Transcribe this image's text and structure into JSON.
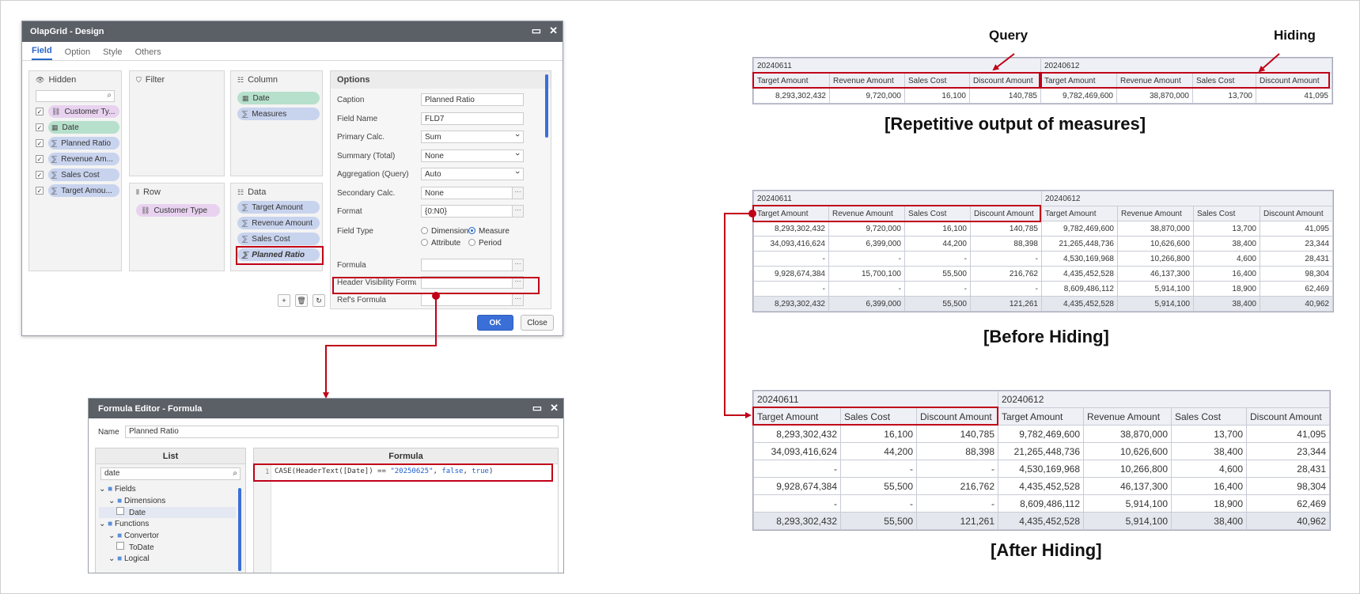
{
  "dialog": {
    "title": "OlapGrid - Design",
    "tabs": [
      "Field",
      "Option",
      "Style",
      "Others"
    ],
    "hidden": {
      "title": "Hidden",
      "items": [
        "Customer Ty...",
        "Date",
        "Planned Ratio",
        "Revenue Am...",
        "Sales Cost",
        "Target Amou..."
      ]
    },
    "filter": {
      "title": "Filter"
    },
    "column": {
      "title": "Column",
      "items": [
        "Date",
        "Measures"
      ]
    },
    "row": {
      "title": "Row",
      "items": [
        "Customer Type"
      ]
    },
    "data": {
      "title": "Data",
      "items": [
        "Target Amount",
        "Revenue Amount",
        "Sales Cost",
        "Planned Ratio"
      ]
    },
    "options": {
      "title": "Options",
      "caption": {
        "label": "Caption",
        "value": "Planned Ratio"
      },
      "field_name": {
        "label": "Field Name",
        "value": "FLD7"
      },
      "primary_calc": {
        "label": "Primary Calc.",
        "value": "Sum"
      },
      "summary_total": {
        "label": "Summary (Total)",
        "value": "None"
      },
      "aggregation": {
        "label": "Aggregation (Query)",
        "value": "Auto"
      },
      "secondary_calc": {
        "label": "Secondary Calc.",
        "value": "None"
      },
      "format": {
        "label": "Format",
        "value": "{0:N0}"
      },
      "field_type": {
        "label": "Field Type",
        "opt1": "Dimension",
        "opt2": "Measure",
        "opt3": "Attribute",
        "opt4": "Period"
      },
      "formula": {
        "label": "Formula",
        "value": ""
      },
      "header_visibility": {
        "label": "Header Visibility Formula",
        "value": ""
      },
      "refs_formula": {
        "label": "Ref's Formula"
      }
    },
    "ok_label": "OK",
    "close_label": "Close"
  },
  "formula_editor": {
    "title": "Formula Editor - Formula",
    "name_label": "Name",
    "name_value": "Planned Ratio",
    "list_header": "List",
    "formula_header": "Formula",
    "search_value": "date",
    "tree": [
      "Fields",
      "Dimensions",
      "Date",
      "Functions",
      "Convertor",
      "ToDate",
      "Logical"
    ],
    "code_line": "1",
    "code": {
      "p1": "CASE(HeaderText([Date]) == ",
      "p2": "\"20250625\"",
      "p3": ", ",
      "p4": "false",
      "p5": ", ",
      "p6": "true",
      "p7": ")"
    }
  },
  "captions": {
    "query": "Query",
    "hiding": "Hiding",
    "repetitive": "[Repetitive output of measures]",
    "before": "[Before Hiding]",
    "after": "[After Hiding]"
  },
  "grid1": {
    "dates": [
      "20240611",
      "20240612"
    ],
    "headers": [
      "Target Amount",
      "Revenue Amount",
      "Sales Cost",
      "Discount Amount",
      "Target Amount",
      "Revenue Amount",
      "Sales Cost",
      "Discount Amount"
    ],
    "rows": [
      [
        "8,293,302,432",
        "9,720,000",
        "16,100",
        "140,785",
        "9,782,469,600",
        "38,870,000",
        "13,700",
        "41,095"
      ]
    ]
  },
  "grid2": {
    "dates": [
      "20240611",
      "20240612"
    ],
    "headers": [
      "Target Amount",
      "Revenue Amount",
      "Sales Cost",
      "Discount Amount",
      "Target Amount",
      "Revenue Amount",
      "Sales Cost",
      "Discount Amount"
    ],
    "rows": [
      [
        "8,293,302,432",
        "9,720,000",
        "16,100",
        "140,785",
        "9,782,469,600",
        "38,870,000",
        "13,700",
        "41,095"
      ],
      [
        "34,093,416,624",
        "6,399,000",
        "44,200",
        "88,398",
        "21,265,448,736",
        "10,626,600",
        "38,400",
        "23,344"
      ],
      [
        "-",
        "-",
        "-",
        "-",
        "4,530,169,968",
        "10,266,800",
        "4,600",
        "28,431"
      ],
      [
        "9,928,674,384",
        "15,700,100",
        "55,500",
        "216,762",
        "4,435,452,528",
        "46,137,300",
        "16,400",
        "98,304"
      ],
      [
        "-",
        "-",
        "-",
        "-",
        "8,609,486,112",
        "5,914,100",
        "18,900",
        "62,469"
      ]
    ],
    "total": [
      "8,293,302,432",
      "6,399,000",
      "55,500",
      "121,261",
      "4,435,452,528",
      "5,914,100",
      "38,400",
      "40,962"
    ]
  },
  "grid3": {
    "dates": [
      "20240611",
      "20240612"
    ],
    "headers": [
      "Target Amount",
      "Sales Cost",
      "Discount Amount",
      "Target Amount",
      "Revenue Amount",
      "Sales Cost",
      "Discount Amount"
    ],
    "rows": [
      [
        "8,293,302,432",
        "16,100",
        "140,785",
        "9,782,469,600",
        "38,870,000",
        "13,700",
        "41,095"
      ],
      [
        "34,093,416,624",
        "44,200",
        "88,398",
        "21,265,448,736",
        "10,626,600",
        "38,400",
        "23,344"
      ],
      [
        "-",
        "-",
        "-",
        "4,530,169,968",
        "10,266,800",
        "4,600",
        "28,431"
      ],
      [
        "9,928,674,384",
        "55,500",
        "216,762",
        "4,435,452,528",
        "46,137,300",
        "16,400",
        "98,304"
      ],
      [
        "-",
        "-",
        "-",
        "8,609,486,112",
        "5,914,100",
        "18,900",
        "62,469"
      ]
    ],
    "total": [
      "8,293,302,432",
      "55,500",
      "121,261",
      "4,435,452,528",
      "5,914,100",
      "38,400",
      "40,962"
    ]
  },
  "colors": {
    "accent": "#2a66c8",
    "highlight_red": "#c00018",
    "title_bar": "#5b5f66"
  }
}
